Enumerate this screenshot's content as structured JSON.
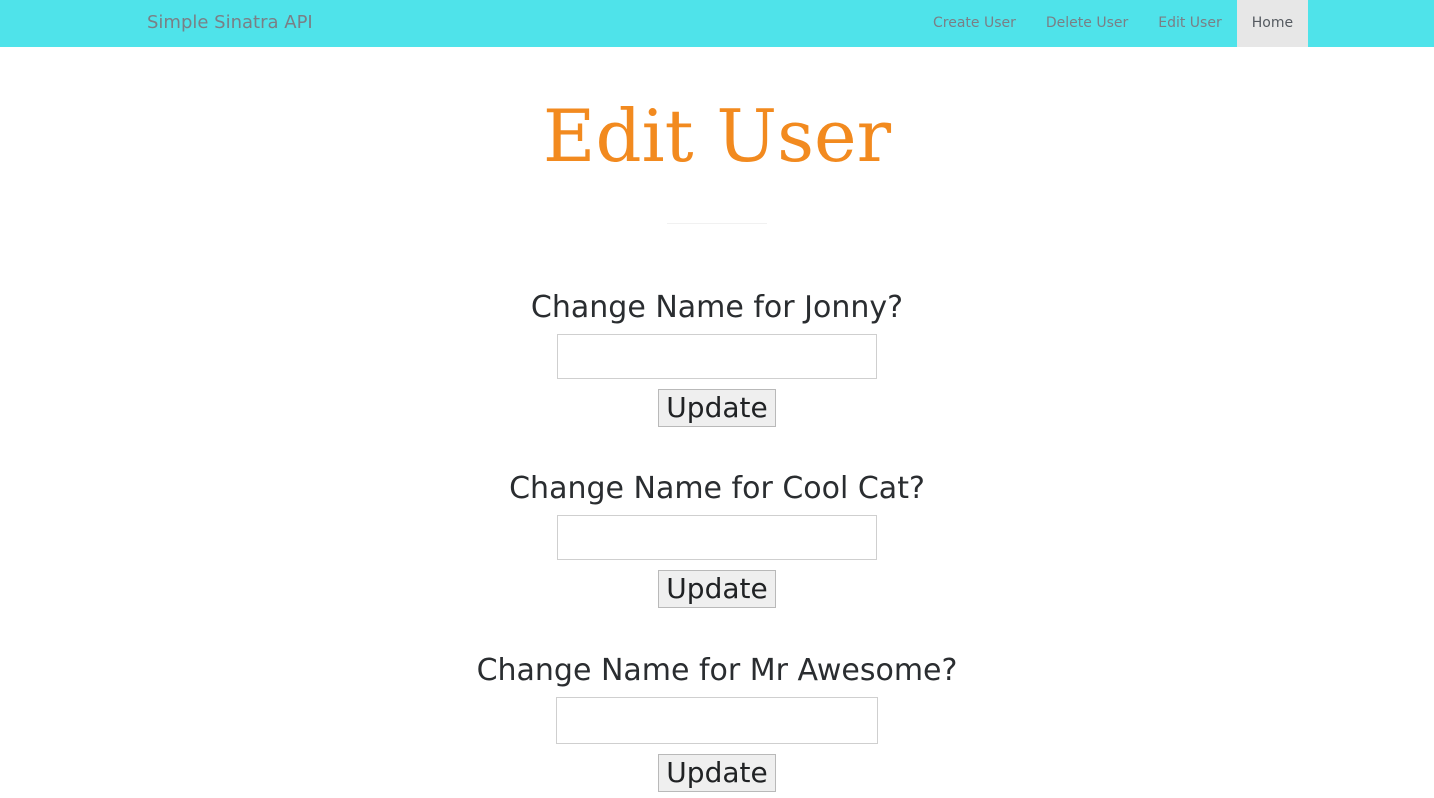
{
  "navbar": {
    "brand": "Simple Sinatra API",
    "items": [
      {
        "label": "Create User"
      },
      {
        "label": "Delete User"
      },
      {
        "label": "Edit User"
      },
      {
        "label": "Home",
        "active": true
      }
    ]
  },
  "page": {
    "title": "Edit User"
  },
  "forms": [
    {
      "label": "Change Name for Jonny?",
      "value": "",
      "placeholder": "",
      "button": "Update"
    },
    {
      "label": "Change Name for Cool Cat?",
      "value": "",
      "placeholder": "",
      "button": "Update"
    },
    {
      "label": "Change Name for Mr Awesome?",
      "value": "",
      "placeholder": "",
      "button": "Update"
    }
  ],
  "colors": {
    "navbar": "#4fe3ea",
    "title": "#f28a1f",
    "active_nav": "#e7e7e7"
  }
}
